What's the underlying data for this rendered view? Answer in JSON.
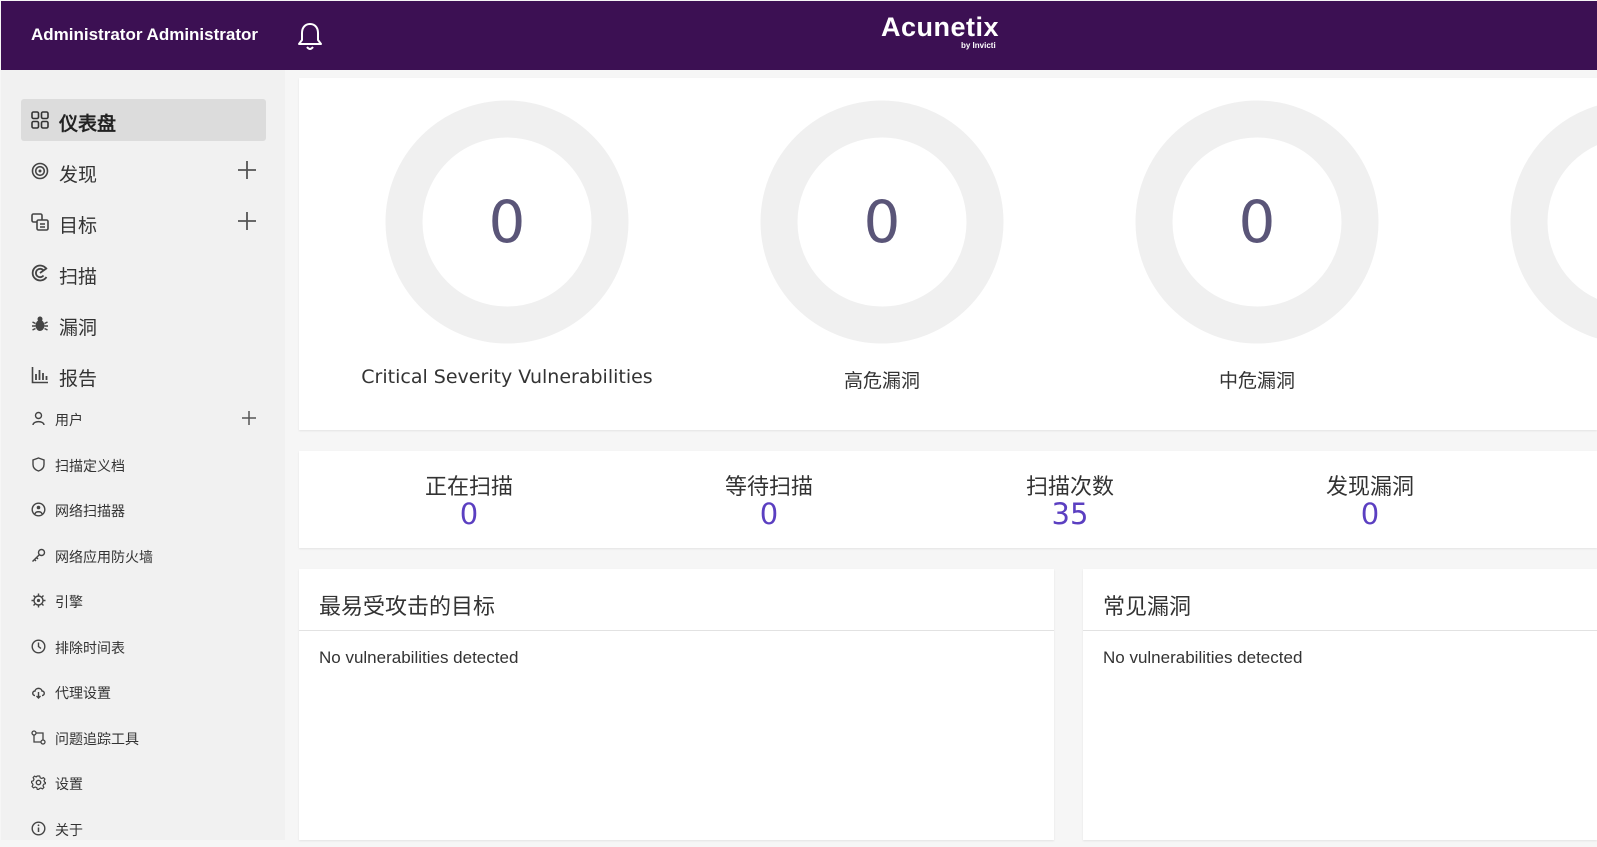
{
  "header": {
    "user_name": "Administrator Administrator",
    "logo_text": "Acunetix",
    "logo_sub": "by Invicti",
    "bar_color": "#3c1053"
  },
  "sidebar": {
    "items": [
      {
        "label": "仪表盘",
        "icon": "dashboard-grid-icon",
        "active": true
      },
      {
        "label": "发现",
        "icon": "target-circle-icon",
        "has_add": true
      },
      {
        "label": "目标",
        "icon": "targets-icon",
        "has_add": true
      },
      {
        "label": "扫描",
        "icon": "scan-radar-icon"
      },
      {
        "label": "漏洞",
        "icon": "bug-icon"
      },
      {
        "label": "报告",
        "icon": "bar-chart-icon"
      },
      {
        "label": "用户",
        "icon": "user-icon",
        "has_add": true
      },
      {
        "label": "扫描定义档",
        "icon": "shield-icon"
      },
      {
        "label": "网络扫描器",
        "icon": "network-scanner-icon"
      },
      {
        "label": "网络应用防火墙",
        "icon": "key-icon"
      },
      {
        "label": "引擎",
        "icon": "engine-gear-icon"
      },
      {
        "label": "排除时间表",
        "icon": "clock-icon"
      },
      {
        "label": "代理设置",
        "icon": "cloud-proxy-icon"
      },
      {
        "label": "问题追踪工具",
        "icon": "issue-tracker-icon"
      },
      {
        "label": "设置",
        "icon": "settings-gear-icon"
      },
      {
        "label": "关于",
        "icon": "info-icon"
      }
    ]
  },
  "severity": [
    {
      "label": "Critical Severity Vulnerabilities",
      "count": "0"
    },
    {
      "label": "高危漏洞",
      "count": "0"
    },
    {
      "label": "中危漏洞",
      "count": "0"
    }
  ],
  "stats": [
    {
      "label": "正在扫描",
      "value": "0"
    },
    {
      "label": "等待扫描",
      "value": "0"
    },
    {
      "label": "扫描次数",
      "value": "35"
    },
    {
      "label": "发现漏洞",
      "value": "0"
    }
  ],
  "panels": {
    "targets": {
      "title": "最易受攻击的目标",
      "body": "No vulnerabilities detected"
    },
    "common": {
      "title": "常见漏洞",
      "body": "No vulnerabilities detected"
    }
  },
  "colors": {
    "accent": "#5b3fc1",
    "donut_ring": "#f0f0f0",
    "donut_number": "#5a5578"
  }
}
